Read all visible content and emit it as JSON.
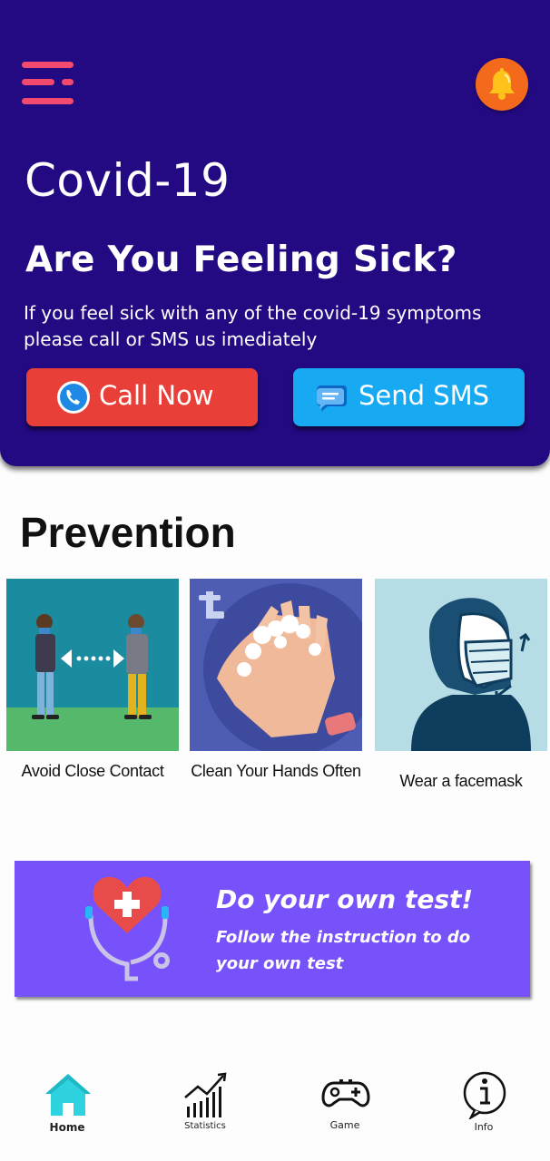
{
  "header": {
    "app_title": "Covid-19",
    "headline": "Are You Feeling Sick?",
    "subtext": "If you feel sick with any of the covid-19 symptoms please call or SMS us imediately",
    "call_button": "Call Now",
    "sms_button": "Send SMS",
    "menu_icon": "hamburger-menu-icon",
    "notification_icon": "bell-icon"
  },
  "prevention": {
    "title": "Prevention",
    "cards": [
      {
        "label": "Avoid Close Contact"
      },
      {
        "label": "Clean Your Hands Often"
      },
      {
        "label": "Wear a facemask"
      }
    ]
  },
  "test_banner": {
    "title": "Do your own test!",
    "subtitle": "Follow the instruction to do your own test"
  },
  "bottom_nav": {
    "items": [
      {
        "label": "Home",
        "icon": "home-icon"
      },
      {
        "label": "Statistics",
        "icon": "statistics-icon"
      },
      {
        "label": "Game",
        "icon": "gamepad-icon"
      },
      {
        "label": "Info",
        "icon": "info-icon"
      }
    ]
  },
  "colors": {
    "header_bg": "#230a82",
    "call_button": "#e84038",
    "sms_button": "#17aaf2",
    "banner_bg": "#7752fb",
    "menu_accent": "#f2496e",
    "bell_bg": "#f36a1d",
    "home_active": "#2fd3e0"
  }
}
